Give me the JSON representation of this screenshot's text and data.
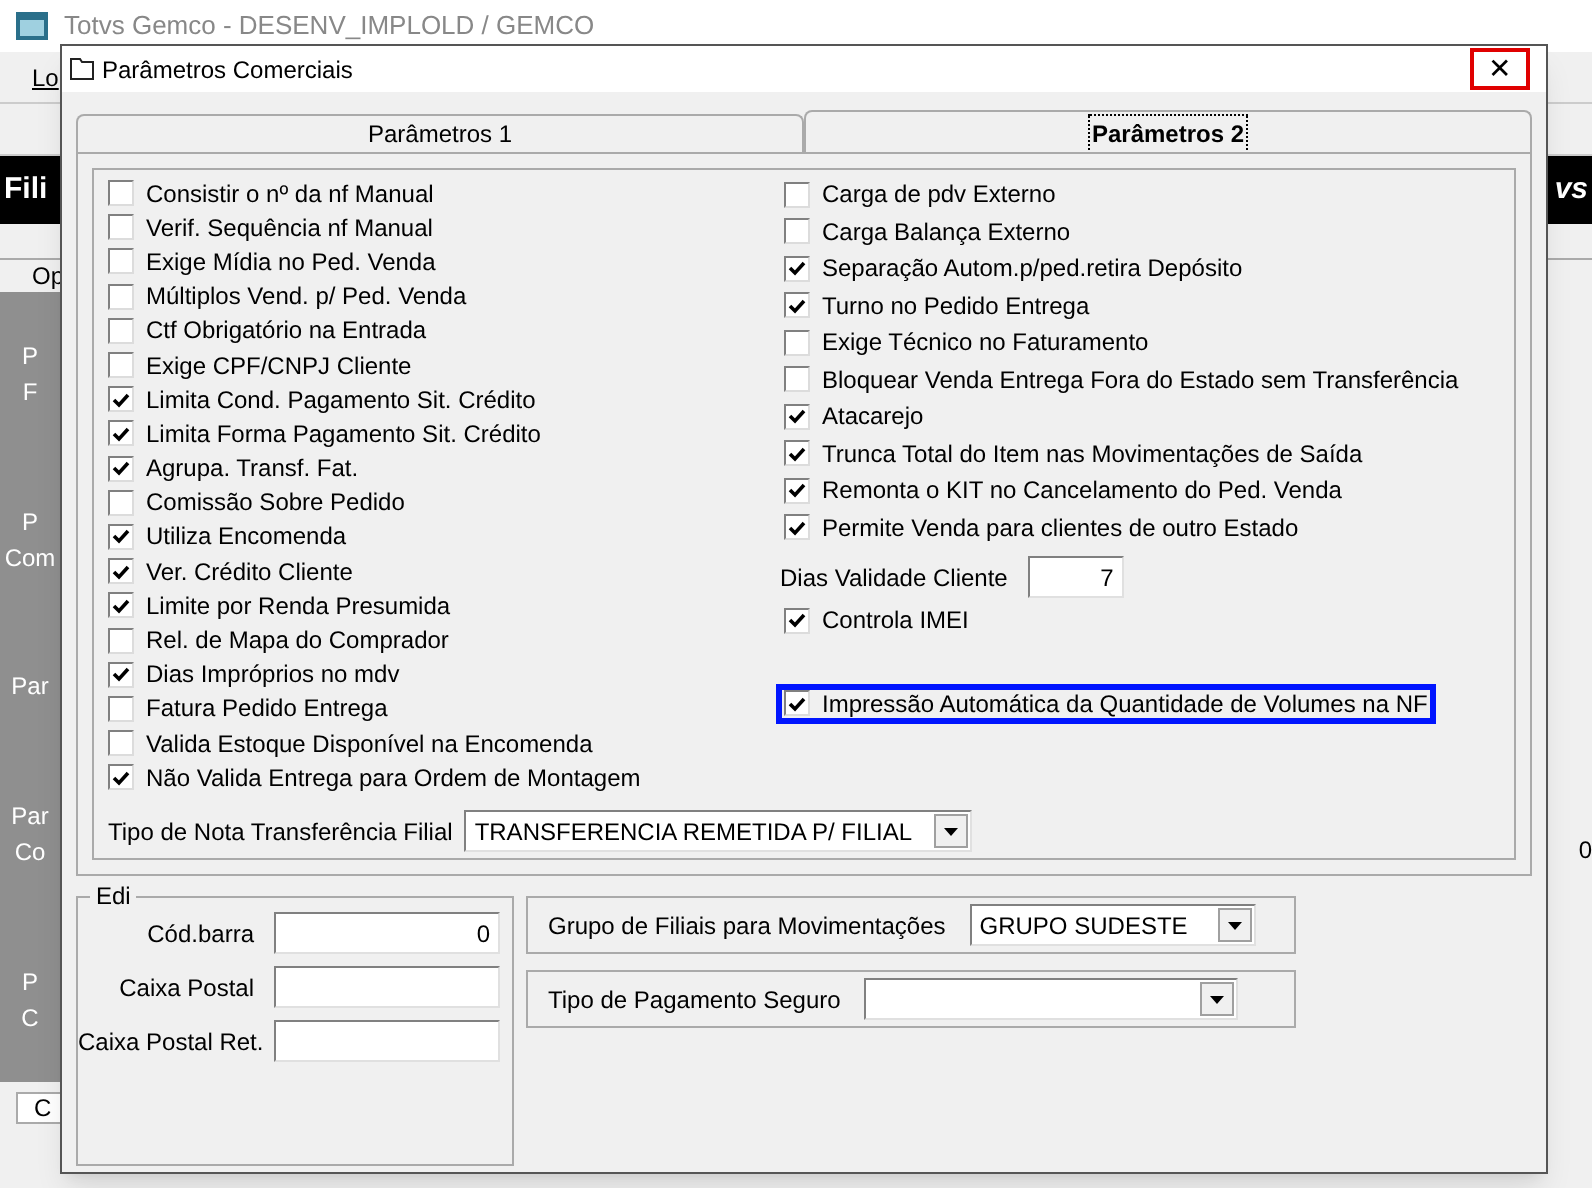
{
  "app_window": {
    "title": "Totvs Gemco - DESENV_IMPLOLD / GEMCO",
    "menu_fragment": "Lo",
    "banner_left": "Fili",
    "banner_right": "vs",
    "column_fragment": "Op",
    "side_fragments": [
      "P\nF",
      "P\nCom",
      "Par",
      "Par\nCo",
      "P\nC"
    ],
    "bottom_fragment": "C",
    "right_value": "0"
  },
  "dialog": {
    "title": "Parâmetros Comerciais",
    "close_button": {
      "label": "✕",
      "highlighted": true
    },
    "tabs": [
      {
        "label": "Parâmetros 1",
        "selected": false
      },
      {
        "label": "Parâmetros 2",
        "selected": true
      }
    ],
    "left_options": [
      {
        "label": "Consistir o nº da nf Manual",
        "checked": false
      },
      {
        "label": "Verif. Sequência nf Manual",
        "checked": false
      },
      {
        "label": "Exige Mídia no Ped. Venda",
        "checked": false
      },
      {
        "label": "Múltiplos Vend. p/ Ped. Venda",
        "checked": false
      },
      {
        "label": "Ctf Obrigatório na Entrada",
        "checked": false
      },
      {
        "label": "Exige CPF/CNPJ Cliente",
        "checked": false
      },
      {
        "label": "Limita Cond. Pagamento Sit. Crédito",
        "checked": true
      },
      {
        "label": "Limita Forma Pagamento Sit. Crédito",
        "checked": true
      },
      {
        "label": "Agrupa. Transf. Fat.",
        "checked": true
      },
      {
        "label": "Comissão Sobre Pedido",
        "checked": false
      },
      {
        "label": "Utiliza Encomenda",
        "checked": true
      },
      {
        "label": "Ver. Crédito Cliente",
        "checked": true
      },
      {
        "label": "Limite por Renda Presumida",
        "checked": true
      },
      {
        "label": "Rel. de Mapa do Comprador",
        "checked": false
      },
      {
        "label": "Dias Impróprios no mdv",
        "checked": true
      },
      {
        "label": "Fatura Pedido Entrega",
        "checked": false
      },
      {
        "label": "Valida Estoque Disponível na Encomenda",
        "checked": false
      },
      {
        "label": "Não Valida Entrega para Ordem de Montagem",
        "checked": true
      }
    ],
    "right_options": [
      {
        "kind": "checkbox",
        "label": "Carga de pdv Externo",
        "checked": false,
        "highlighted": false
      },
      {
        "kind": "checkbox",
        "label": "Carga Balança Externo",
        "checked": false,
        "highlighted": false
      },
      {
        "kind": "checkbox",
        "label": "Separação Autom.p/ped.retira Depósito",
        "checked": true,
        "highlighted": false
      },
      {
        "kind": "checkbox",
        "label": "Turno no Pedido Entrega",
        "checked": true,
        "highlighted": false
      },
      {
        "kind": "checkbox",
        "label": "Exige Técnico no Faturamento",
        "checked": false,
        "highlighted": false
      },
      {
        "kind": "checkbox",
        "label": "Bloquear Venda Entrega Fora do Estado sem Transferência",
        "checked": false,
        "highlighted": false
      },
      {
        "kind": "checkbox",
        "label": "Atacarejo",
        "checked": true,
        "highlighted": false
      },
      {
        "kind": "checkbox",
        "label": "Trunca Total do Item nas Movimentações de Saída",
        "checked": true,
        "highlighted": false
      },
      {
        "kind": "checkbox",
        "label": "Remonta o KIT no Cancelamento do Ped. Venda",
        "checked": true,
        "highlighted": false
      },
      {
        "kind": "checkbox",
        "label": "Permite Venda para clientes de outro Estado",
        "checked": true,
        "highlighted": false
      },
      {
        "kind": "field",
        "label": "Dias Validade Cliente",
        "value": "7"
      },
      {
        "kind": "checkbox",
        "label": "Controla IMEI",
        "checked": true,
        "highlighted": false
      },
      {
        "kind": "checkbox",
        "label": "Impressão Automática da Quantidade de Volumes na NF",
        "checked": true,
        "highlighted": true
      }
    ],
    "transfer_note_type": {
      "label": "Tipo de Nota Transferência Filial",
      "value": "TRANSFERENCIA REMETIDA P/ FILIAL"
    },
    "edi": {
      "title": "Edi",
      "fields": [
        {
          "label": "Cód.barra",
          "value": "0"
        },
        {
          "label": "Caixa Postal"
        },
        {
          "label": "Caixa Postal Ret."
        }
      ]
    },
    "branch_group": {
      "label": "Grupo de Filiais para Movimentações",
      "value": "GRUPO SUDESTE"
    },
    "insurance_payment": {
      "label": "Tipo de Pagamento Seguro"
    }
  }
}
